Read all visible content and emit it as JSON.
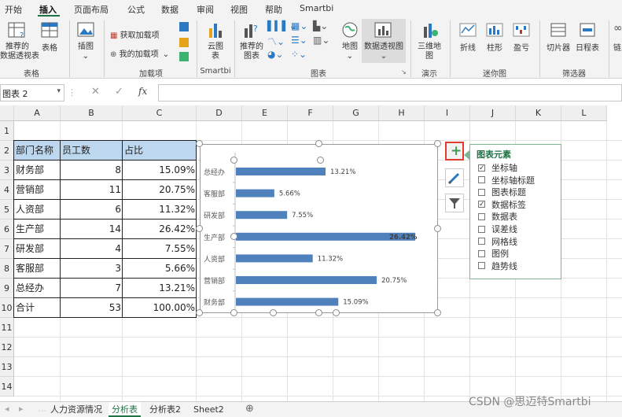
{
  "tabs": [
    "开始",
    "插入",
    "页面布局",
    "公式",
    "数据",
    "审阅",
    "视图",
    "帮助",
    "Smartbi"
  ],
  "ribbon": {
    "rec_pivot": "推荐的\n数据透视表",
    "table": "表格",
    "illustrations": "插图",
    "get_addins": "获取加载项",
    "my_addins": "我的加载项",
    "cloud_chart": "云图",
    "cloud_chart_sub": "表",
    "rec_charts": "推荐的",
    "rec_charts2": "图表",
    "map": "地图",
    "pivot_chart": "数据透视图",
    "map3d": "三维地",
    "map3d2": "图",
    "spark_line": "折线",
    "spark_col": "柱形",
    "spark_wl": "盈亏",
    "slicer": "切片器",
    "timeline": "日程表",
    "link": "链",
    "groups": {
      "tables": "表格",
      "addins": "加载项",
      "smartbi": "Smartbi",
      "charts": "图表",
      "demo": "演示",
      "sparklines": "迷你图",
      "filters": "筛选器"
    }
  },
  "namebox": "图表 2",
  "fx": "fx",
  "columns": [
    "A",
    "B",
    "C",
    "D",
    "E",
    "F",
    "G",
    "H",
    "I",
    "J",
    "K",
    "L"
  ],
  "rows": [
    "1",
    "2",
    "3",
    "4",
    "5",
    "6",
    "7",
    "8",
    "9",
    "10",
    "11",
    "12",
    "13",
    "14"
  ],
  "table": {
    "headers": [
      "部门名称",
      "员工数",
      "占比"
    ],
    "body": [
      [
        "财务部",
        "8",
        "15.09%"
      ],
      [
        "营销部",
        "11",
        "20.75%"
      ],
      [
        "人资部",
        "6",
        "11.32%"
      ],
      [
        "生产部",
        "14",
        "26.42%"
      ],
      [
        "研发部",
        "4",
        "7.55%"
      ],
      [
        "客服部",
        "3",
        "5.66%"
      ],
      [
        "总经办",
        "7",
        "13.21%"
      ],
      [
        "合计",
        "53",
        "100.00%"
      ]
    ]
  },
  "chart_data": {
    "type": "bar",
    "orientation": "horizontal",
    "categories": [
      "总经办",
      "客服部",
      "研发部",
      "生产部",
      "人资部",
      "营销部",
      "财务部"
    ],
    "values": [
      13.21,
      5.66,
      7.55,
      26.42,
      11.32,
      20.75,
      15.09
    ],
    "labels": [
      "13.21%",
      "5.66%",
      "7.55%",
      "26.42%",
      "11.32%",
      "20.75%",
      "15.09%"
    ],
    "xlim": [
      0,
      28
    ],
    "bar_color": "#4f81bd",
    "grid": false,
    "legend": "none"
  },
  "chart_elements": {
    "title": "图表元素",
    "items": [
      {
        "label": "坐标轴",
        "checked": true
      },
      {
        "label": "坐标轴标题",
        "checked": false
      },
      {
        "label": "图表标题",
        "checked": false
      },
      {
        "label": "数据标签",
        "checked": true
      },
      {
        "label": "数据表",
        "checked": false
      },
      {
        "label": "误差线",
        "checked": false
      },
      {
        "label": "网格线",
        "checked": false
      },
      {
        "label": "图例",
        "checked": false
      },
      {
        "label": "趋势线",
        "checked": false
      }
    ]
  },
  "sheets": [
    "人力资源情况",
    "分析表",
    "分析表2",
    "Sheet2"
  ],
  "add_sheet": "⊕",
  "watermark": "CSDN @思迈特Smartbi",
  "colors": {
    "accent": "#217346",
    "header_fill": "#bdd7ee",
    "plus_btn": "#e03c31"
  }
}
